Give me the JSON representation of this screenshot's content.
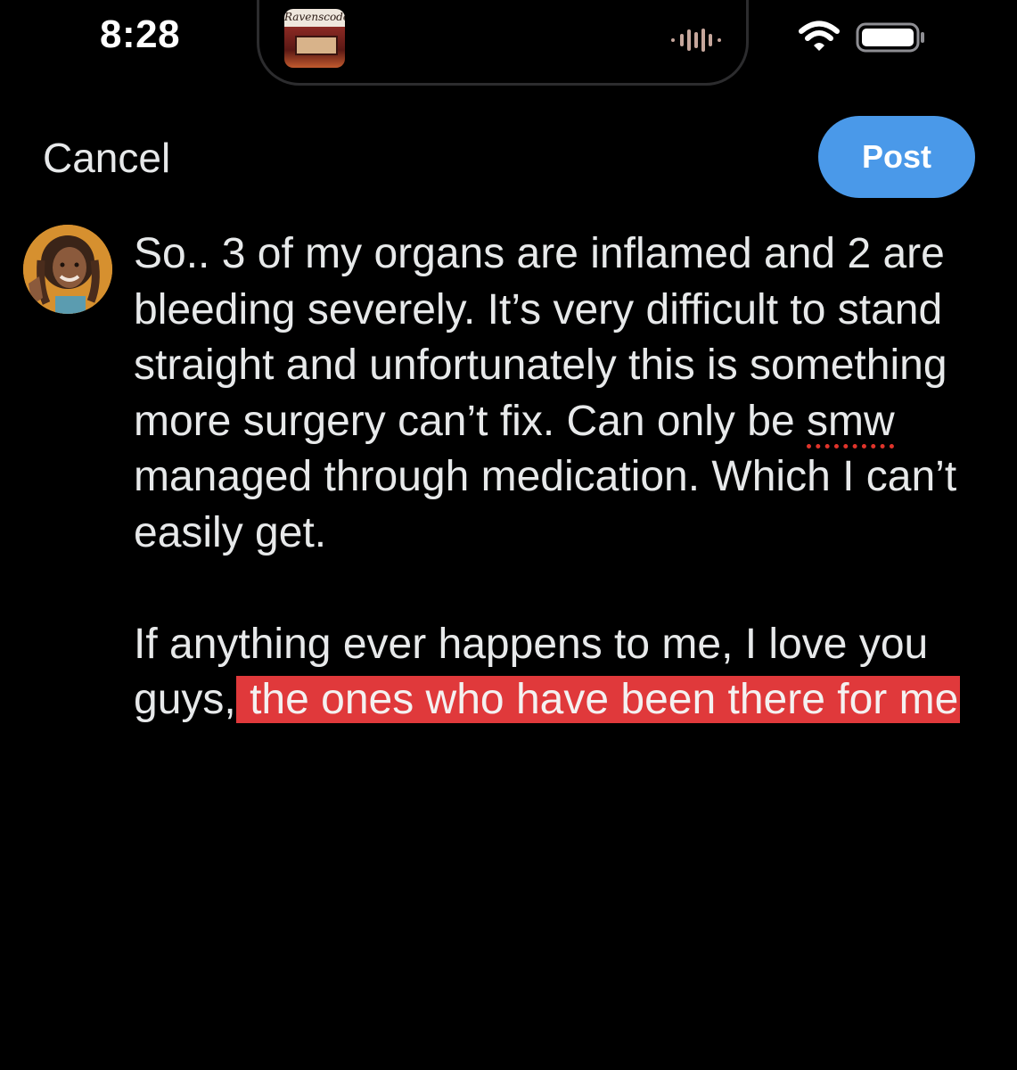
{
  "status_bar": {
    "time": "8:28",
    "now_playing_art_text": "Ravenscode",
    "icons": [
      "audio-waveform-icon",
      "wifi-icon",
      "battery-icon"
    ]
  },
  "compose": {
    "cancel_label": "Cancel",
    "post_label": "Post",
    "accent_color": "#4a99e9",
    "highlight_color": "#e0393b"
  },
  "tweet": {
    "para1_part1": "So.. 3 of my organs are inflamed and 2 are bleeding severely. It’s very difficult to stand straight and unfortunately this is something more surgery can’t fix. Can only be ",
    "para1_misspelled": "smw",
    "para1_part2": " managed through medication. Which I can’t easily get.",
    "para2_plain": "If anything ever happens to me, I love you guys,",
    "para2_highlighted": " the ones who have been there for me"
  }
}
